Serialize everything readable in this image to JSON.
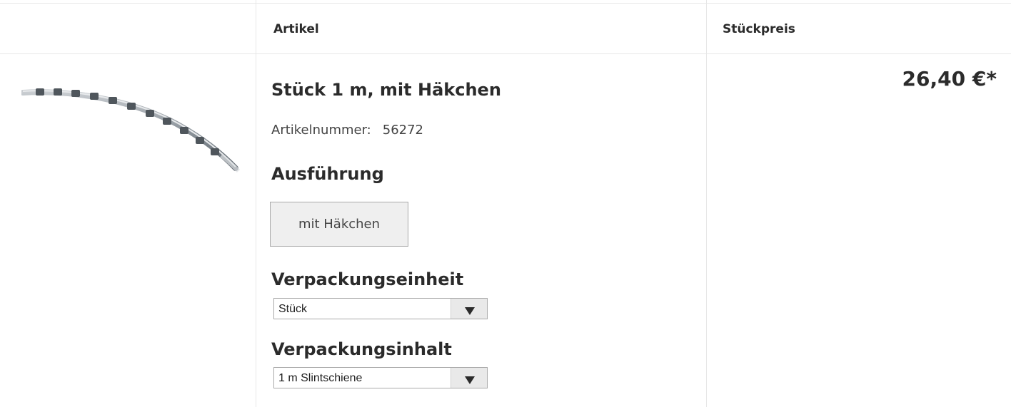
{
  "header": {
    "col_article": "Artikel",
    "col_unit_price": "Stückpreis"
  },
  "product": {
    "title": "Stück 1 m, mit Häkchen",
    "article_number_label": "Artikelnummer:",
    "article_number": "56272",
    "variant_section_label": "Ausführung",
    "variant_option": "mit Häkchen",
    "packaging_unit_label": "Verpackungseinheit",
    "packaging_unit_value": "Stück",
    "packaging_content_label": "Verpackungsinhalt",
    "packaging_content_value": "1 m Slintschiene",
    "price": "26,40 €*",
    "image_icon": "slint-rail-image"
  },
  "colors": {
    "border": "#e7e7e7",
    "text": "#2b2b2b",
    "button_bg": "#efefef"
  }
}
